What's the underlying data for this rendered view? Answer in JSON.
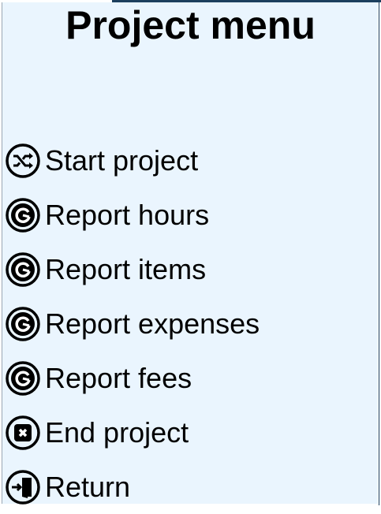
{
  "title": "Project menu",
  "menu": [
    {
      "label": "Start project",
      "icon": "shuffle-icon"
    },
    {
      "label": "Report hours",
      "icon": "report-icon"
    },
    {
      "label": "Report items",
      "icon": "report-icon"
    },
    {
      "label": "Report expenses",
      "icon": "report-icon"
    },
    {
      "label": "Report fees",
      "icon": "report-icon"
    },
    {
      "label": "End project",
      "icon": "stop-icon"
    },
    {
      "label": "Return",
      "icon": "exit-door-icon"
    }
  ],
  "colors": {
    "background": "#eaf5fe",
    "text": "#000000",
    "frame_accent": "#1c3f5e"
  }
}
